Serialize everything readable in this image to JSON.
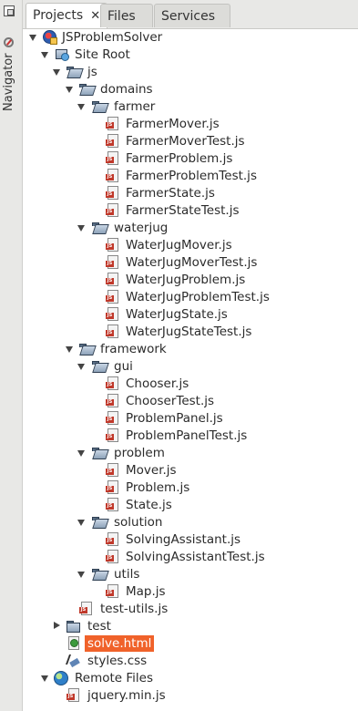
{
  "sidebar": {
    "navigator_label": "Navigator"
  },
  "tabs": [
    {
      "label": "Projects",
      "active": true,
      "close": "✕"
    },
    {
      "label": "Files",
      "active": false
    },
    {
      "label": "Services",
      "active": false
    }
  ],
  "tree": [
    {
      "label": "JSProblemSolver",
      "icon": "project-icon",
      "expander": "open"
    },
    {
      "label": "Site Root",
      "icon": "site-root-icon",
      "expander": "open"
    },
    {
      "label": "js",
      "icon": "folder-open-icon",
      "expander": "open"
    },
    {
      "label": "domains",
      "icon": "folder-open-icon",
      "expander": "open"
    },
    {
      "label": "farmer",
      "icon": "folder-open-icon",
      "expander": "open"
    },
    {
      "label": "FarmerMover.js",
      "icon": "js-file-icon"
    },
    {
      "label": "FarmerMoverTest.js",
      "icon": "js-file-icon"
    },
    {
      "label": "FarmerProblem.js",
      "icon": "js-file-icon"
    },
    {
      "label": "FarmerProblemTest.js",
      "icon": "js-file-icon"
    },
    {
      "label": "FarmerState.js",
      "icon": "js-file-icon"
    },
    {
      "label": "FarmerStateTest.js",
      "icon": "js-file-icon"
    },
    {
      "label": "waterjug",
      "icon": "folder-open-icon",
      "expander": "open"
    },
    {
      "label": "WaterJugMover.js",
      "icon": "js-file-icon"
    },
    {
      "label": "WaterJugMoverTest.js",
      "icon": "js-file-icon"
    },
    {
      "label": "WaterJugProblem.js",
      "icon": "js-file-icon"
    },
    {
      "label": "WaterJugProblemTest.js",
      "icon": "js-file-icon"
    },
    {
      "label": "WaterJugState.js",
      "icon": "js-file-icon"
    },
    {
      "label": "WaterJugStateTest.js",
      "icon": "js-file-icon"
    },
    {
      "label": "framework",
      "icon": "folder-open-icon",
      "expander": "open"
    },
    {
      "label": "gui",
      "icon": "folder-open-icon",
      "expander": "open"
    },
    {
      "label": "Chooser.js",
      "icon": "js-file-icon"
    },
    {
      "label": "ChooserTest.js",
      "icon": "js-file-icon"
    },
    {
      "label": "ProblemPanel.js",
      "icon": "js-file-icon"
    },
    {
      "label": "ProblemPanelTest.js",
      "icon": "js-file-icon"
    },
    {
      "label": "problem",
      "icon": "folder-open-icon",
      "expander": "open"
    },
    {
      "label": "Mover.js",
      "icon": "js-file-icon"
    },
    {
      "label": "Problem.js",
      "icon": "js-file-icon"
    },
    {
      "label": "State.js",
      "icon": "js-file-icon"
    },
    {
      "label": "solution",
      "icon": "folder-open-icon",
      "expander": "open"
    },
    {
      "label": "SolvingAssistant.js",
      "icon": "js-file-icon"
    },
    {
      "label": "SolvingAssistantTest.js",
      "icon": "js-file-icon"
    },
    {
      "label": "utils",
      "icon": "folder-open-icon",
      "expander": "open"
    },
    {
      "label": "Map.js",
      "icon": "js-file-icon"
    },
    {
      "label": "test-utils.js",
      "icon": "js-file-icon"
    },
    {
      "label": "test",
      "icon": "folder-icon",
      "expander": "closed"
    },
    {
      "label": "solve.html",
      "icon": "html-file-icon",
      "selected": true
    },
    {
      "label": "styles.css",
      "icon": "css-file-icon"
    },
    {
      "label": "Remote Files",
      "icon": "globe-icon",
      "expander": "open"
    },
    {
      "label": "jquery.min.js",
      "icon": "js-file-icon"
    }
  ],
  "colors": {
    "selection": "#f0622a"
  }
}
